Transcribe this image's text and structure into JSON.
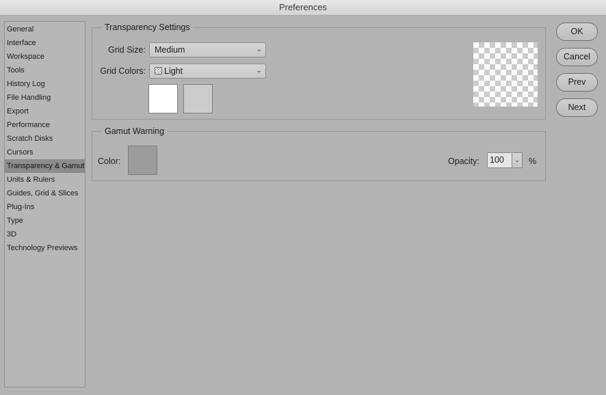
{
  "window": {
    "title": "Preferences"
  },
  "sidebar": {
    "selected_index": 10,
    "items": [
      "General",
      "Interface",
      "Workspace",
      "Tools",
      "History Log",
      "File Handling",
      "Export",
      "Performance",
      "Scratch Disks",
      "Cursors",
      "Transparency & Gamut",
      "Units & Rulers",
      "Guides, Grid & Slices",
      "Plug-Ins",
      "Type",
      "3D",
      "Technology Previews"
    ]
  },
  "transparency": {
    "legend": "Transparency Settings",
    "grid_size_label": "Grid Size:",
    "grid_size_value": "Medium",
    "grid_colors_label": "Grid Colors:",
    "grid_colors_value": "Light",
    "grid_color_1": "#ffffff",
    "grid_color_2": "#cccccc"
  },
  "gamut": {
    "legend": "Gamut Warning",
    "color_label": "Color:",
    "color_value": "#9c9c9c",
    "opacity_label": "Opacity:",
    "opacity_value": "100",
    "opacity_unit": "%"
  },
  "buttons": {
    "ok": "OK",
    "cancel": "Cancel",
    "prev": "Prev",
    "next": "Next"
  },
  "icons": {
    "dropdown": "chevron-down-icon",
    "grid_colors": "checkerboard-icon"
  }
}
